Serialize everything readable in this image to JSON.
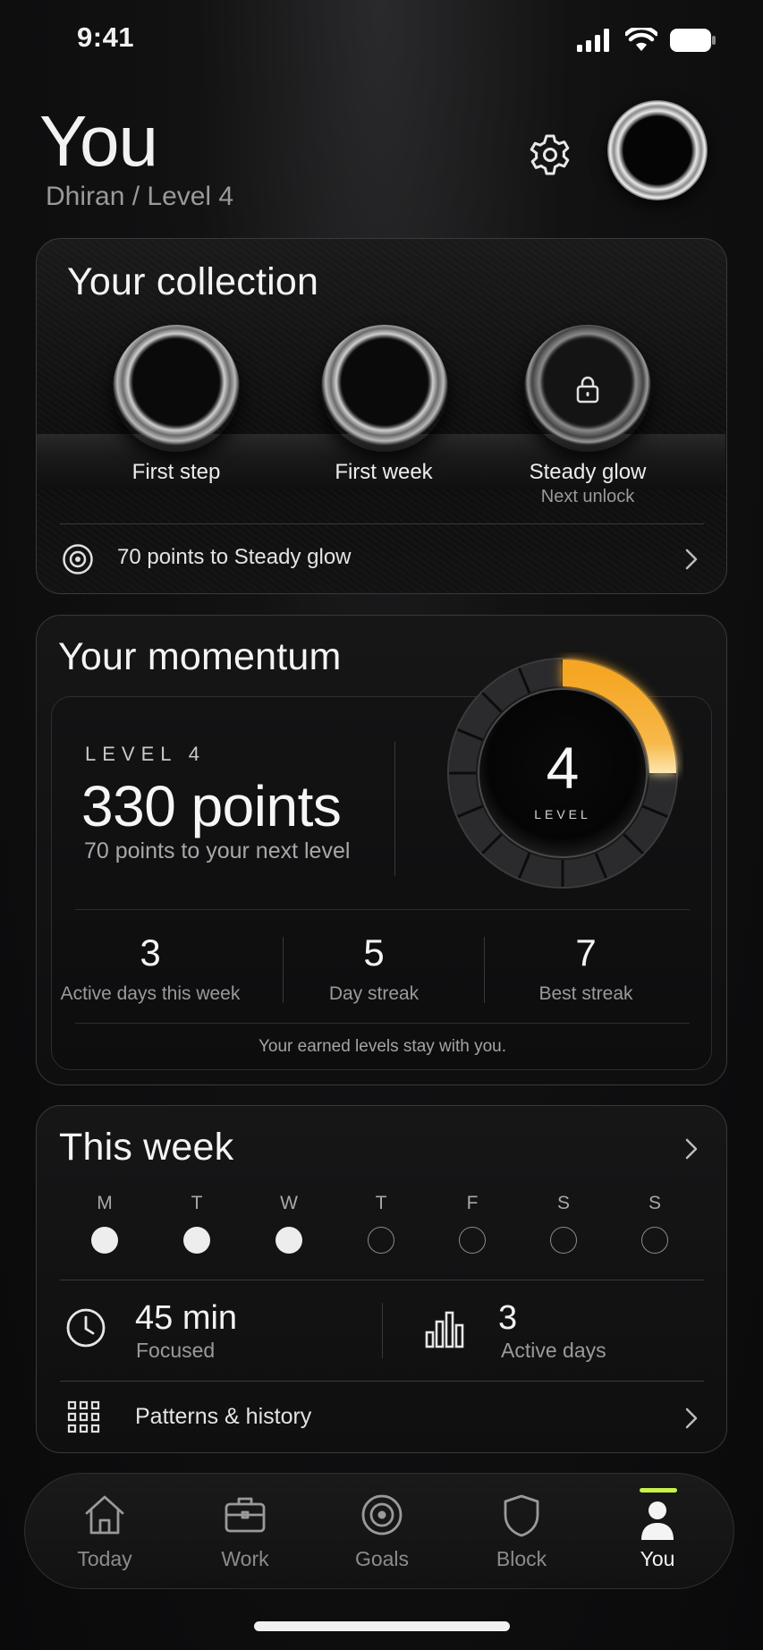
{
  "status_bar": {
    "time": "9:41"
  },
  "header": {
    "title": "You",
    "subtitle": "Dhiran / Level 4"
  },
  "collection": {
    "title": "Your collection",
    "badges": [
      {
        "label": "First step",
        "sub": "",
        "icon": "badge-ring-icon",
        "locked": false
      },
      {
        "label": "First week",
        "sub": "",
        "icon": "badge-ring-icon",
        "locked": false
      },
      {
        "label": "Steady glow",
        "sub": "Next unlock",
        "icon": "lock-icon",
        "locked": true
      }
    ],
    "progress_text": "70 points to Steady glow"
  },
  "momentum": {
    "title": "Your momentum",
    "level_eyebrow": "LEVEL 4",
    "points": "330 points",
    "points_sub": "70 points to your next level",
    "dial": {
      "level": "4",
      "label": "LEVEL",
      "progress_fraction": 0.25,
      "accent": "#f5a623"
    },
    "stats": [
      {
        "value": "3",
        "label": "Active days this week"
      },
      {
        "value": "5",
        "label": "Day streak"
      },
      {
        "value": "7",
        "label": "Best streak"
      }
    ],
    "footnote": "Your earned levels stay with you."
  },
  "week": {
    "title": "This week",
    "days": [
      {
        "letter": "M",
        "active": true
      },
      {
        "letter": "T",
        "active": true
      },
      {
        "letter": "W",
        "active": true
      },
      {
        "letter": "T",
        "active": false
      },
      {
        "letter": "F",
        "active": false
      },
      {
        "letter": "S",
        "active": false
      },
      {
        "letter": "S",
        "active": false
      }
    ],
    "focused": {
      "value": "45 min",
      "label": "Focused"
    },
    "active_days": {
      "value": "3",
      "label": "Active days"
    },
    "history_label": "Patterns & history"
  },
  "tabs": [
    {
      "label": "Today",
      "icon": "home-icon",
      "active": false
    },
    {
      "label": "Work",
      "icon": "briefcase-icon",
      "active": false
    },
    {
      "label": "Goals",
      "icon": "target-icon",
      "active": false
    },
    {
      "label": "Block",
      "icon": "shield-icon",
      "active": false
    },
    {
      "label": "You",
      "icon": "person-icon",
      "active": true
    }
  ],
  "colors": {
    "accent_active_tab": "#c8f24a",
    "dial_accent": "#f5a623",
    "background": "#0a0a0b"
  }
}
